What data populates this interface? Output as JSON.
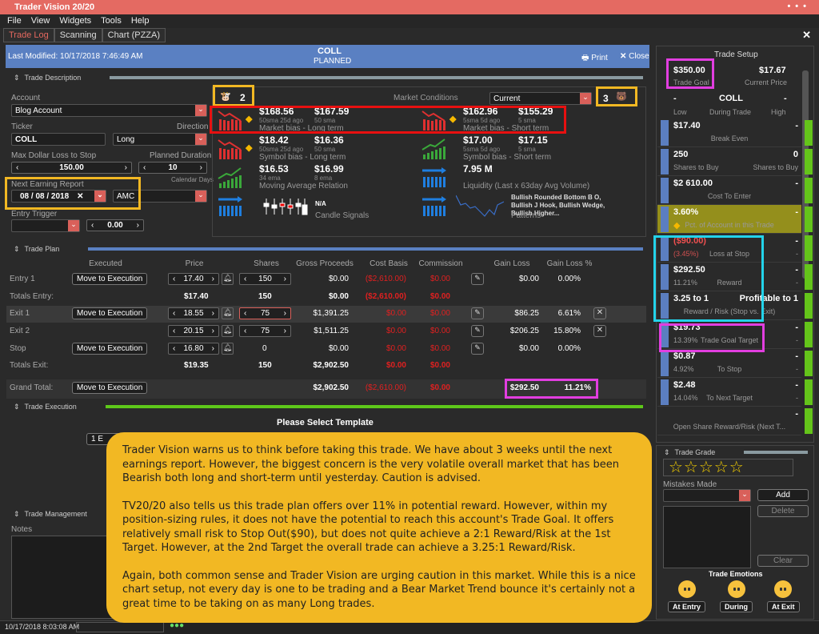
{
  "app": {
    "title": "Trader Vision 20/20"
  },
  "menu": [
    "File",
    "View",
    "Widgets",
    "Tools",
    "Help"
  ],
  "tabs": [
    "Trade Log",
    "Scanning",
    "Chart (PZZA)"
  ],
  "header": {
    "last_modified": "Last Modified: 10/17/2018 7:46:49 AM",
    "ticker": "COLL",
    "status": "PLANNED",
    "print": "Print",
    "close": "Close"
  },
  "desc": {
    "section": "Trade Description",
    "account_label": "Account",
    "account": "Blog Account",
    "ticker_label": "Ticker",
    "ticker": "COLL",
    "direction_label": "Direction",
    "direction": "Long",
    "max_loss_label": "Max Dollar Loss to Stop",
    "max_loss": "150.00",
    "duration_label": "Planned Duration",
    "duration": "10",
    "duration_unit": "Calendar Days",
    "earning_label": "Next Earning Report",
    "earning_date": "08 / 08 / 2018",
    "earning_time": "AMC",
    "trigger_label": "Entry Trigger",
    "trigger_value": "0.00"
  },
  "market": {
    "bull_count": "2",
    "bear_count": "3",
    "label": "Market Conditions",
    "selected": "Current",
    "rows": [
      {
        "v1": "$168.56",
        "s1": "50sma 25d ago",
        "v2": "$167.59",
        "s2": "50 sma",
        "cap": "Market bias - Long term",
        "trend": "down",
        "warn": true
      },
      {
        "v1": "$162.96",
        "s1": "5sma 5d ago",
        "v2": "$155.29",
        "s2": "5 sma",
        "cap": "Market bias - Short term",
        "trend": "down",
        "warn": true
      },
      {
        "v1": "$18.42",
        "s1": "50sma 25d ago",
        "v2": "$16.36",
        "s2": "50 sma",
        "cap": "Symbol bias - Long term",
        "trend": "down",
        "warn": true
      },
      {
        "v1": "$17.00",
        "s1": "5sma 5d ago",
        "v2": "$17.15",
        "s2": "5 sma",
        "cap": "Symbol bias - Short term",
        "trend": "up"
      },
      {
        "v1": "$16.53",
        "s1": "34 ema",
        "v2": "$16.99",
        "s2": "8 ema",
        "cap": "Moving Average Relation",
        "trend": "up"
      },
      {
        "v1": "7.95 M",
        "s1": "",
        "v2": "",
        "s2": "",
        "cap": "Liquidity (Last x 63day Avg Volume)",
        "trend": "flat"
      },
      {
        "v1": "N/A",
        "cap": "Candle Signals",
        "trend": "flat"
      },
      {
        "v1": "Bullish Rounded Bottom B O, Bullish J Hook, Bullish Wedge, Bullish Higher...",
        "cap": "Patterns",
        "trend": "flat"
      }
    ]
  },
  "plan": {
    "section": "Trade Plan",
    "columns": [
      "Executed",
      "Price",
      "Shares",
      "Gross Proceeds",
      "Cost Basis",
      "Commission",
      "Gain Loss",
      "Gain Loss %"
    ],
    "move_label": "Move to Execution",
    "rows": [
      {
        "label": "Entry 1",
        "move": true,
        "price": "17.40",
        "shares": "150",
        "gross": "$0.00",
        "cost": "($2,610.00)",
        "comm": "$0.00",
        "gl": "$0.00",
        "glp": "0.00%",
        "edit": true
      },
      {
        "label": "Totals Entry:",
        "price": "$17.40",
        "shares": "150",
        "gross": "$0.00",
        "cost": "($2,610.00)",
        "comm": "$0.00",
        "total": true
      },
      {
        "label": "Exit 1",
        "move": true,
        "price": "18.55",
        "shares": "75",
        "gross": "$1,391.25",
        "cost": "$0.00",
        "comm": "$0.00",
        "gl": "$86.25",
        "glp": "6.61%",
        "edit": true,
        "del": true
      },
      {
        "label": "Exit 2",
        "price": "20.15",
        "shares": "75",
        "gross": "$1,511.25",
        "cost": "$0.00",
        "comm": "$0.00",
        "gl": "$206.25",
        "glp": "15.80%",
        "edit": true,
        "del": true
      },
      {
        "label": "Stop",
        "move": true,
        "price": "16.80",
        "shares": "0",
        "gross": "$0.00",
        "cost": "$0.00",
        "comm": "$0.00",
        "gl": "$0.00",
        "glp": "0.00%",
        "edit": true
      },
      {
        "label": "Totals Exit:",
        "price": "$19.35",
        "shares": "150",
        "gross": "$2,902.50",
        "cost": "$0.00",
        "comm": "$0.00",
        "total": true
      }
    ],
    "grand": {
      "label": "Grand Total:",
      "gross": "$2,902.50",
      "cost": "($2,610.00)",
      "comm": "$0.00",
      "gl": "$292.50",
      "glp": "11.21%"
    }
  },
  "execution": {
    "section": "Trade Execution",
    "template": "Please Select Template",
    "button": "1 E"
  },
  "management": {
    "section": "Trade Management",
    "notes": "Notes"
  },
  "status": {
    "time": "10/17/2018 8:03:08 AM"
  },
  "setup": {
    "title": "Trade Setup",
    "goal": "$350.00",
    "goal_label": "Trade Goal",
    "price": "$17.67",
    "price_label": "Current Price",
    "low": "-",
    "ticker": "COLL",
    "high": "-",
    "low_label": "Low",
    "during_label": "During Trade",
    "high_label": "High",
    "rows": [
      {
        "v": "$17.40",
        "r": "-",
        "c": "Break Even"
      },
      {
        "v": "250",
        "r": "0",
        "l": "Shares to Buy",
        "rl": "Shares to Buy"
      },
      {
        "v": "$2 610.00",
        "r": "-",
        "c": "Cost To Enter"
      },
      {
        "v": "3.60%",
        "r": "-",
        "c": "Pct. of Account in this Trade",
        "warn": true
      },
      {
        "v": "($90.00)",
        "r": "-",
        "l": "(3.45%)",
        "c": "Loss at Stop",
        "rl": "-",
        "red": true
      },
      {
        "v": "$292.50",
        "r": "-",
        "l": "11.21%",
        "c": "Reward",
        "rl": "-"
      },
      {
        "v": "3.25 to 1",
        "r": "Profitable to 1",
        "c": "Reward / Risk (Stop vs. Exit)"
      },
      {
        "v": "$19.73",
        "r": "-",
        "l": "13.39%",
        "c": "Trade Goal Target",
        "rl": "-"
      },
      {
        "v": "$0.87",
        "r": "-",
        "l": "4.92%",
        "c": "To Stop",
        "rl": "-"
      },
      {
        "v": "$2.48",
        "r": "-",
        "l": "14.04%",
        "c": "To Next Target",
        "rl": "-"
      },
      {
        "v": "",
        "r": "-",
        "c": "Open Share Reward/Risk (Next T..."
      }
    ]
  },
  "grade": {
    "section": "Trade Grade",
    "stars": 0,
    "mistakes_label": "Mistakes Made",
    "add": "Add",
    "delete": "Delete",
    "clear": "Clear",
    "emotions_label": "Trade Emotions",
    "emotions": [
      "At Entry",
      "During",
      "At Exit"
    ]
  },
  "callout": {
    "p1": "Trader Vision warns us to think before taking this trade.  We have about 3 weeks until the next earnings report.  However, the biggest concern is the very volatile overall market that has been Bearish both long and short-term until yesterday.  Caution is advised.",
    "p2": "TV20/20 also tells us this trade plan offers over 11% in potential reward.  However, within my position-sizing rules, it does not have the potential to reach this account's  Trade Goal.  It offers relatively small risk to Stop Out($90), but does not quite achieve a 2:1 Reward/Risk at the 1st Target.  However, at the 2nd Target the overall trade can achieve a 3.25:1 Reward/Risk.",
    "p3": "Again, both common sense and Trader Vision are urging caution in this market.  While this is a nice chart setup, not every day is one to be trading and a Bear Market Trend bounce it's certainly not a great time to be taking on as many Long trades."
  },
  "colors": {
    "titlebar": "#e46a62",
    "header": "#5a80c2",
    "accent_green": "#64c41a",
    "highlight_magenta": "#e23ee0",
    "highlight_yellow": "#f2b823",
    "highlight_red": "#e81010",
    "highlight_cyan": "#23d3ea"
  }
}
